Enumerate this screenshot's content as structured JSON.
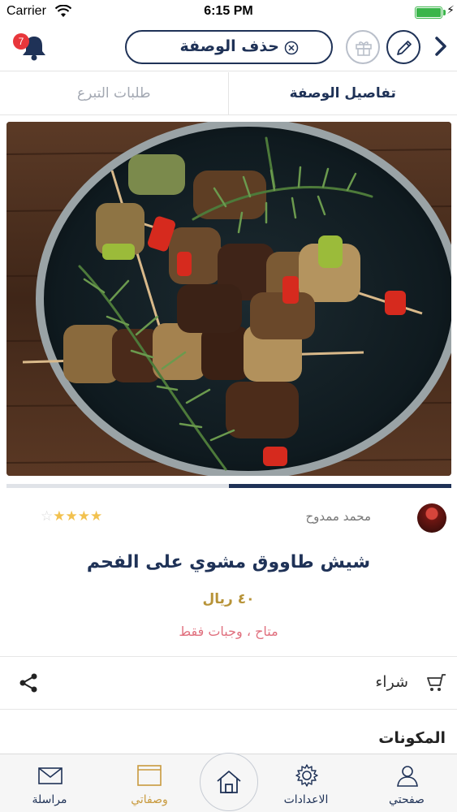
{
  "status_bar": {
    "carrier": "Carrier",
    "time": "6:15 PM",
    "battery_level": 1.0
  },
  "nav": {
    "notification_count": "7",
    "delete_recipe_label": "حذف الوصفة",
    "icons": [
      "bell-icon",
      "close-circle-icon",
      "gift-icon",
      "pencil-icon",
      "chevron-right-icon"
    ]
  },
  "tabs": {
    "details": "تفاصيل الوصفة",
    "donation": "طلبات التبرع"
  },
  "gallery": {
    "progress": 0.5
  },
  "recipe": {
    "author": "محمد ممدوح",
    "rating": 4.5,
    "rating_max": 5,
    "title": "شيش طاووق مشوي على الفحم",
    "price": "٤٠ ريال",
    "availability": "متاح ، وجبات فقط",
    "buy_label": "شراء",
    "ingredients_heading": "المكونات"
  },
  "bottom_bar": {
    "mail": "مراسلة",
    "my_recipes": "وصفاتي",
    "settings": "الاعدادات",
    "my_page": "صفحتي",
    "active_color": "#c89a3e",
    "primary_color": "#1f3257"
  }
}
